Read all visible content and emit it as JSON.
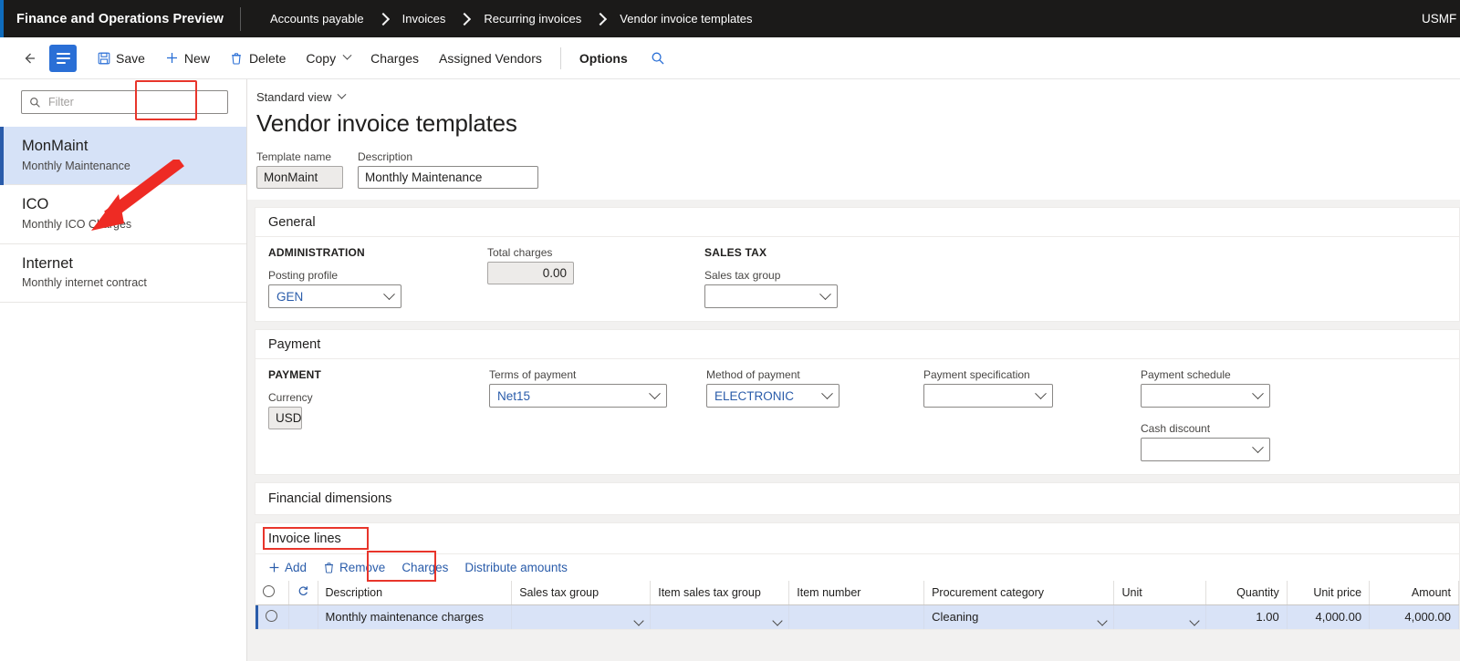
{
  "topbar": {
    "app_title": "Finance and Operations Preview",
    "breadcrumb": [
      "Accounts payable",
      "Invoices",
      "Recurring invoices",
      "Vendor invoice templates"
    ],
    "company": "USMF"
  },
  "commandbar": {
    "back_icon": "back-arrow-icon",
    "menu_icon": "hamburger-icon",
    "save_label": "Save",
    "new_label": "New",
    "delete_label": "Delete",
    "copy_label": "Copy",
    "charges_label": "Charges",
    "assigned_vendors_label": "Assigned Vendors",
    "options_label": "Options",
    "search_icon": "search-icon"
  },
  "sidebar": {
    "filter_placeholder": "Filter",
    "filter_value": "",
    "items": [
      {
        "title": "MonMaint",
        "subtitle": "Monthly Maintenance",
        "selected": true
      },
      {
        "title": "ICO",
        "subtitle": "Monthly ICO Charges",
        "selected": false
      },
      {
        "title": "Internet",
        "subtitle": "Monthly internet contract",
        "selected": false
      }
    ]
  },
  "page": {
    "view_label": "Standard view",
    "title": "Vendor invoice templates",
    "template_name_label": "Template name",
    "template_name_value": "MonMaint",
    "description_label": "Description",
    "description_value": "Monthly Maintenance"
  },
  "general": {
    "section_title": "General",
    "administration_group": "ADMINISTRATION",
    "posting_profile_label": "Posting profile",
    "posting_profile_value": "GEN",
    "total_charges_label": "Total charges",
    "total_charges_value": "0.00",
    "sales_tax_group_header": "SALES TAX",
    "sales_tax_group_label": "Sales tax group",
    "sales_tax_group_value": ""
  },
  "payment": {
    "section_title": "Payment",
    "payment_group": "PAYMENT",
    "currency_label": "Currency",
    "currency_value": "USD",
    "terms_label": "Terms of payment",
    "terms_value": "Net15",
    "method_label": "Method of payment",
    "method_value": "ELECTRONIC",
    "specification_label": "Payment specification",
    "specification_value": "",
    "schedule_label": "Payment schedule",
    "schedule_value": "",
    "cash_discount_label": "Cash discount",
    "cash_discount_value": ""
  },
  "financial_dimensions": {
    "section_title": "Financial dimensions"
  },
  "invoice_lines": {
    "section_title": "Invoice lines",
    "toolbar": {
      "add_label": "Add",
      "remove_label": "Remove",
      "charges_label": "Charges",
      "distribute_label": "Distribute amounts"
    },
    "columns": [
      "Description",
      "Sales tax group",
      "Item sales tax group",
      "Item number",
      "Procurement category",
      "Unit",
      "Quantity",
      "Unit price",
      "Amount"
    ],
    "rows": [
      {
        "description": "Monthly maintenance charges",
        "sales_tax_group": "",
        "item_sales_tax_group": "",
        "item_number": "",
        "procurement_category": "Cleaning",
        "unit": "",
        "quantity": "1.00",
        "unit_price": "4,000.00",
        "amount": "4,000.00"
      }
    ]
  },
  "annotations": {
    "highlight_color": "#e8352b",
    "arrow_color": "#ee2b24",
    "highlighted": [
      "New",
      "Invoice lines",
      "Charges"
    ]
  }
}
